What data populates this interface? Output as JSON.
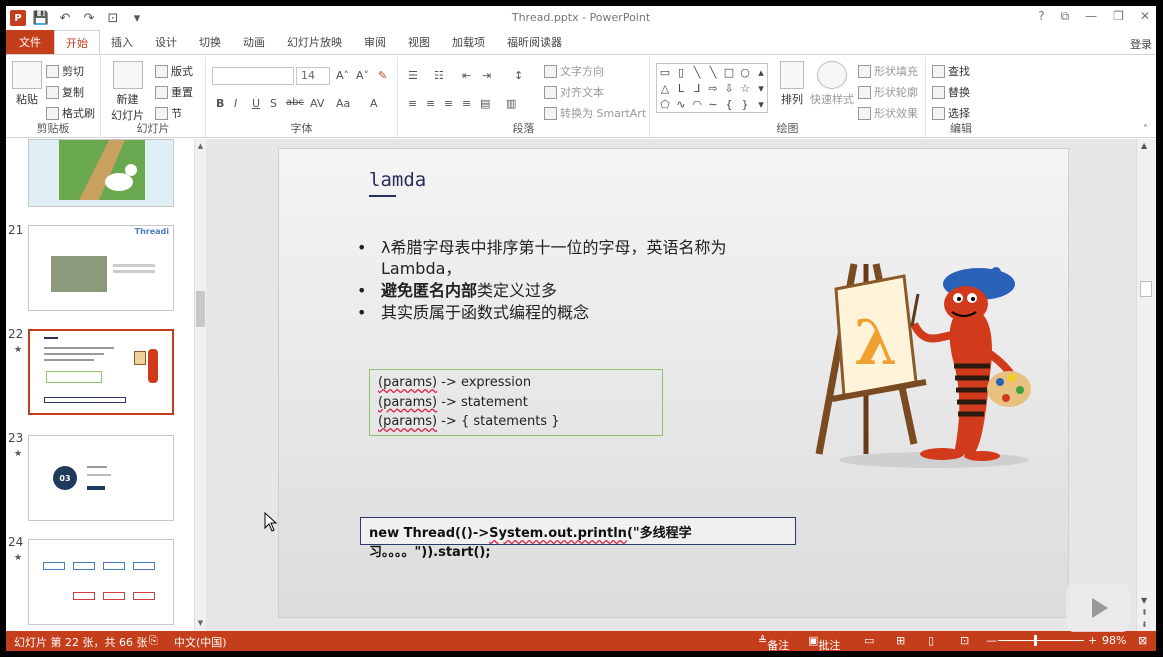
{
  "window": {
    "title": "Thread.pptx - PowerPoint",
    "controls": [
      "?",
      "⧉",
      "—",
      "❐",
      "✕"
    ],
    "login": "登录"
  },
  "qat": [
    "💾",
    "↶",
    "↷",
    "⊡",
    "▾"
  ],
  "tabs": [
    "文件",
    "开始",
    "插入",
    "设计",
    "切换",
    "动画",
    "幻灯片放映",
    "审阅",
    "视图",
    "加载项",
    "福昕阅读器"
  ],
  "ribbon": {
    "clipboard": {
      "label": "剪贴板",
      "paste": "粘贴",
      "cut": "剪切",
      "copy": "复制",
      "format_painter": "格式刷"
    },
    "slides": {
      "label": "幻灯片",
      "new_slide": "新建\n幻灯片",
      "layout": "版式",
      "reset": "重置",
      "section": "节"
    },
    "font": {
      "label": "字体",
      "size": "14",
      "grow": "A˄",
      "shrink": "A˅",
      "clear": "✎",
      "bold": "B",
      "italic": "I",
      "underline": "U",
      "shadow": "S",
      "strike": "abc",
      "spacing": "AV",
      "case": "Aa",
      "color": "A"
    },
    "paragraph": {
      "label": "段落",
      "text_dir": "文字方向",
      "align_text": "对齐文本",
      "smartart": "转换为 SmartArt"
    },
    "drawing": {
      "label": "绘图",
      "arrange": "排列",
      "quick_styles": "快速样式",
      "fill": "形状填充",
      "outline": "形状轮廓",
      "effects": "形状效果"
    },
    "editing": {
      "label": "编辑",
      "find": "查找",
      "replace": "替换",
      "select": "选择"
    }
  },
  "thumbnails": [
    {
      "num": "21",
      "caption": "Threadi"
    },
    {
      "num": "22"
    },
    {
      "num": "23",
      "badge": "03"
    },
    {
      "num": "24"
    }
  ],
  "slide": {
    "title": "lamda",
    "bullets": [
      {
        "text": "λ希腊字母表中排序第十一位的字母，英语名称为 Lambda，"
      },
      {
        "bold": "避免匿名内部",
        "text": "类定义过多"
      },
      {
        "text": "其实质属于函数式编程的概念"
      }
    ],
    "code_lines": [
      {
        "a": "(params)",
        "b": " -> expression"
      },
      {
        "a": "(params)",
        "b": " -> statement"
      },
      {
        "a": "(params)",
        "b": " -> { statements }"
      }
    ],
    "thread_code": {
      "pre": "new Thread(()->",
      "sys": "System.out.println",
      "post": "(\"多线程学习。。。。\")).start();"
    }
  },
  "status": {
    "slide_info": "幻灯片 第 22 张，共 66 张",
    "language": "中文(中国)",
    "notes": "备注",
    "comments": "批注",
    "zoom": "98%"
  },
  "colors": {
    "accent": "#c43e1c",
    "slide_title": "#2a2f5a",
    "code_border": "#8dc26f"
  }
}
